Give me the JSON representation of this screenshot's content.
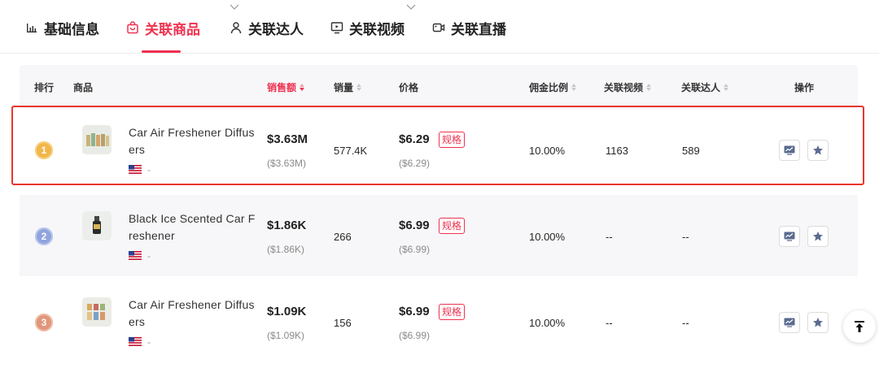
{
  "tabs": [
    {
      "label": "基础信息",
      "icon": "bar-chart-icon"
    },
    {
      "label": "关联商品",
      "icon": "shopping-bag-icon",
      "active": true
    },
    {
      "label": "关联达人",
      "icon": "user-icon"
    },
    {
      "label": "关联视频",
      "icon": "video-screen-icon"
    },
    {
      "label": "关联直播",
      "icon": "live-camera-icon"
    }
  ],
  "table": {
    "headers": {
      "rank": "排行",
      "product": "商品",
      "sales_amount": "销售额",
      "sales_volume": "销量",
      "price": "价格",
      "commission": "佣金比例",
      "videos": "关联视频",
      "creators": "关联达人",
      "actions": "操作"
    },
    "rows": [
      {
        "rank": "1",
        "name": "Car Air Freshener Diffusers",
        "flag": "US",
        "flag_suffix": "-",
        "sales": "$3.63M",
        "sales_sub": "($3.63M)",
        "volume": "577.4K",
        "price": "$6.29",
        "spec_label": "规格",
        "price_sub": "($6.29)",
        "commission": "10.00%",
        "videos": "1163",
        "creators": "589"
      },
      {
        "rank": "2",
        "name": "Black Ice Scented Car Freshener",
        "flag": "US",
        "flag_suffix": "-",
        "sales": "$1.86K",
        "sales_sub": "($1.86K)",
        "volume": "266",
        "price": "$6.99",
        "spec_label": "规格",
        "price_sub": "($6.99)",
        "commission": "10.00%",
        "videos": "--",
        "creators": "--"
      },
      {
        "rank": "3",
        "name": "Car Air Freshener Diffusers",
        "flag": "US",
        "flag_suffix": "-",
        "sales": "$1.09K",
        "sales_sub": "($1.09K)",
        "volume": "156",
        "price": "$6.99",
        "spec_label": "规格",
        "price_sub": "($6.99)",
        "commission": "10.00%",
        "videos": "--",
        "creators": "--"
      }
    ]
  },
  "colors": {
    "accent": "#f0314e",
    "highlight_border": "#e8362d",
    "gold": "#f2b64a",
    "silver": "#8fa4dc",
    "bronze": "#e0967a"
  }
}
